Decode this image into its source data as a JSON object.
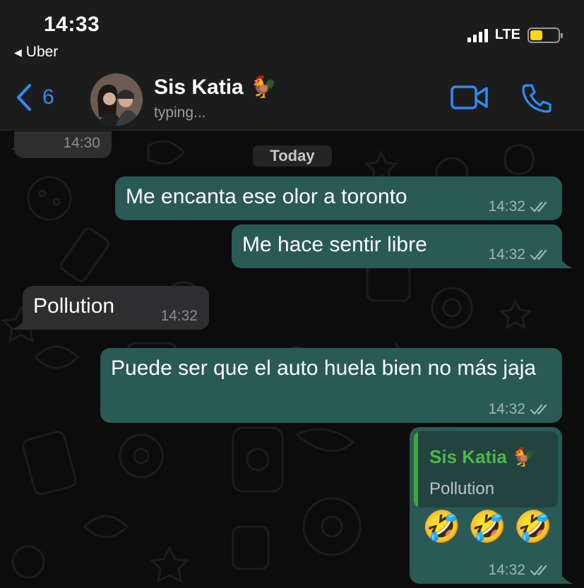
{
  "status_bar": {
    "time": "14:33",
    "back_app": "Uber",
    "network": "LTE"
  },
  "header": {
    "back_count": "6",
    "contact_name": "Sis Katia",
    "contact_emoji": "🐓",
    "contact_status": "typing...",
    "icons": [
      "chevron-left-icon",
      "video-camera-icon",
      "phone-icon"
    ],
    "accent_color": "#2f8cf7"
  },
  "chat": {
    "previous_time": "14:30",
    "date_divider": "Today",
    "messages": [
      {
        "direction": "out",
        "text": "Me encanta ese olor a toronto",
        "time": "14:32",
        "read": true
      },
      {
        "direction": "out",
        "text": "Me hace sentir libre",
        "time": "14:32",
        "read": true
      },
      {
        "direction": "in",
        "text": "Pollution",
        "time": "14:32"
      },
      {
        "direction": "out",
        "text": "Puede ser que el auto huela bien no más jaja",
        "time": "14:32",
        "read": true
      },
      {
        "direction": "out",
        "reply_to": {
          "name": "Sis Katia",
          "emoji": "🐓",
          "text": "Pollution"
        },
        "text": "🤣🤣🤣",
        "time": "14:32",
        "read": true
      }
    ],
    "colors": {
      "outgoing": "#2a5a55",
      "incoming": "#2e2e30",
      "quote_bar": "#3ea73b"
    }
  }
}
